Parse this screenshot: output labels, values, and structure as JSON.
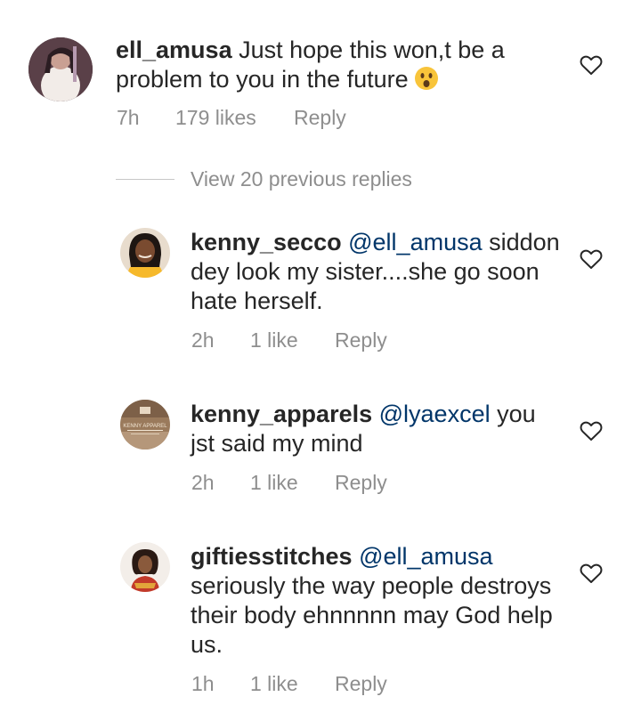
{
  "comments": [
    {
      "username": "ell_amusa",
      "mention": "",
      "text": "Just hope this won,t be a problem to you in the future",
      "time": "7h",
      "likes": "179 likes",
      "reply": "Reply"
    },
    {
      "username": "kenny_secco",
      "mention": "@ell_amusa",
      "text": "siddon dey look my sister....she go soon hate herself.",
      "time": "2h",
      "likes": "1 like",
      "reply": "Reply"
    },
    {
      "username": "kenny_apparels",
      "mention": "@lyaexcel",
      "text": "you jst said my mind",
      "time": "2h",
      "likes": "1 like",
      "reply": "Reply"
    },
    {
      "username": "giftiesstitches",
      "mention": "@ell_amusa",
      "text": "seriously the way people destroys their body ehnnnnn may God help us.",
      "time": "1h",
      "likes": "1 like",
      "reply": "Reply"
    }
  ],
  "view_replies": "View 20 previous replies",
  "icons": {
    "like": "heart-outline-icon",
    "emoji": "astonished-face-emoji"
  },
  "avatar_brand_text": "KENNY APPAREL",
  "colors": {
    "text": "#262626",
    "meta": "#8e8e8e",
    "mention": "#003569"
  }
}
